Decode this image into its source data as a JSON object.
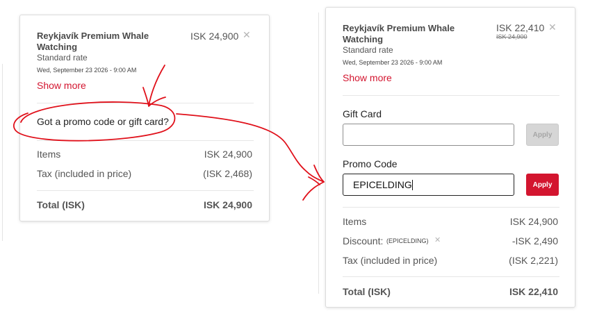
{
  "left_card": {
    "product_title": "Reykjavík Premium Whale Watching",
    "rate": "Standard rate",
    "date": "Wed, September 23 2026 - 9:00 AM",
    "price": "ISK 24,900",
    "show_more": "Show more",
    "promo_prompt": "Got a promo code or gift card?",
    "items_label": "Items",
    "items_value": "ISK 24,900",
    "tax_label": "Tax (included in price)",
    "tax_value": "(ISK 2,468)",
    "total_label": "Total (ISK)",
    "total_value": "ISK 24,900"
  },
  "right_card": {
    "product_title": "Reykjavík Premium Whale Watching",
    "rate": "Standard rate",
    "date": "Wed, September 23 2026 - 9:00 AM",
    "price": "ISK 22,410",
    "old_price": "ISK 24,900",
    "show_more": "Show more",
    "gift_card_label": "Gift Card",
    "gift_card_value": "",
    "gift_apply_label": "Apply",
    "promo_label": "Promo Code",
    "promo_value": "EPICELDING",
    "promo_apply_label": "Apply",
    "items_label": "Items",
    "items_value": "ISK 24,900",
    "discount_label": "Discount:",
    "discount_code": "(EPICELDING)",
    "discount_value": "-ISK 2,490",
    "tax_label": "Tax (included in price)",
    "tax_value": "(ISK 2,221)",
    "total_label": "Total (ISK)",
    "total_value": "ISK 22,410"
  },
  "colors": {
    "accent": "#d3152f",
    "annotation": "#e0101a",
    "disabled_button": "#d6d6d6"
  },
  "icons": {
    "close": "close-icon",
    "remove_discount": "close-icon"
  }
}
